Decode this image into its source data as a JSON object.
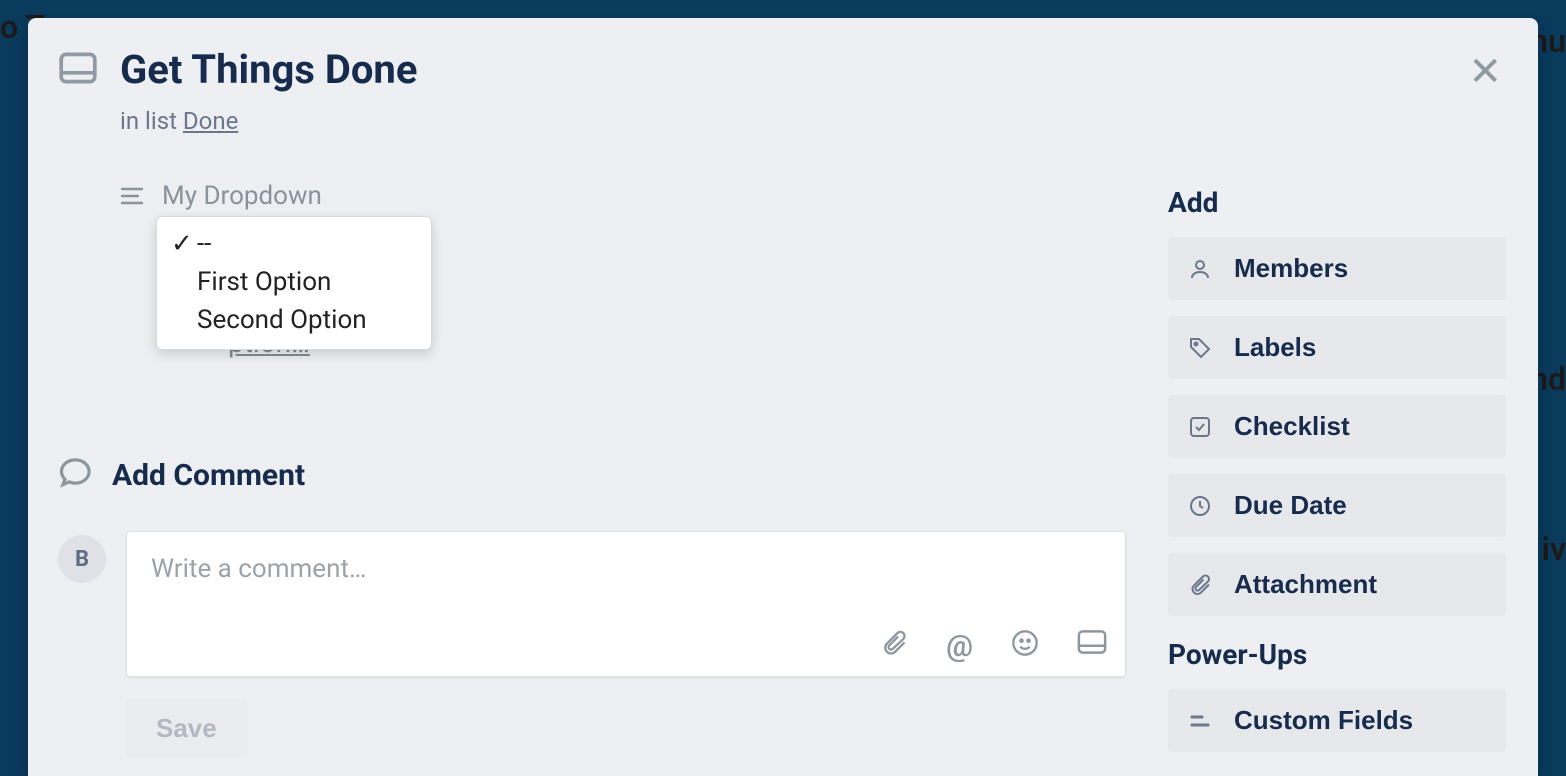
{
  "background": {
    "peek_top_left": "o T",
    "peek_top_right": "nu",
    "peek_mid_right": "nd",
    "peek_low_right": "iv"
  },
  "card": {
    "title": "Get Things Done",
    "in_list_prefix": "in list ",
    "list_name": "Done",
    "custom_field_label": "My Dropdown",
    "dropdown_options": {
      "selected_index": 0,
      "items": [
        "--",
        "First Option",
        "Second Option"
      ]
    },
    "edit_description_peek": "ption…"
  },
  "comment": {
    "section_title": "Add Comment",
    "avatar_initial": "B",
    "placeholder": "Write a comment…",
    "save_label": "Save"
  },
  "sidebar": {
    "add_title": "Add",
    "buttons": [
      {
        "id": "members",
        "label": "Members"
      },
      {
        "id": "labels",
        "label": "Labels"
      },
      {
        "id": "checklist",
        "label": "Checklist"
      },
      {
        "id": "due-date",
        "label": "Due Date"
      },
      {
        "id": "attachment",
        "label": "Attachment"
      }
    ],
    "powerups_title": "Power-Ups",
    "powerups": [
      {
        "id": "custom-fields",
        "label": "Custom Fields"
      }
    ]
  }
}
